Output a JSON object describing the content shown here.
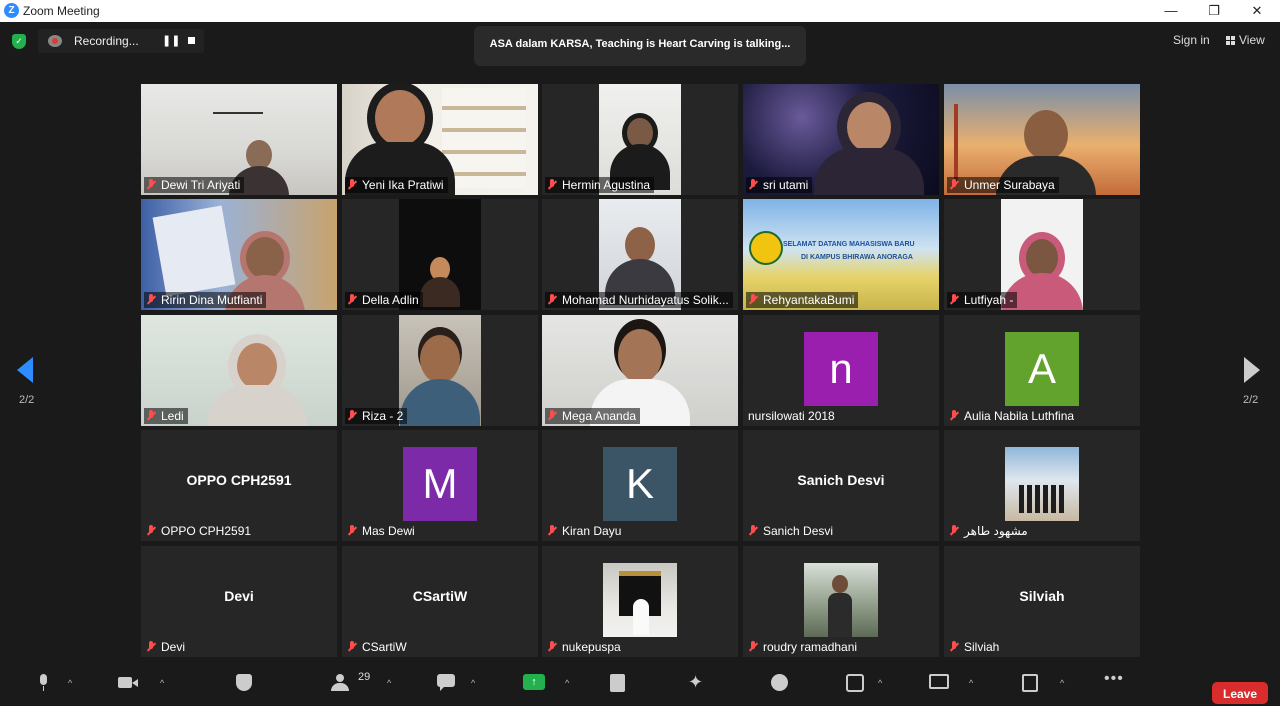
{
  "window": {
    "title": "Zoom Meeting",
    "minimize": "—",
    "restore": "❐",
    "close": "✕"
  },
  "topbar": {
    "recording_label": "Recording...",
    "talking": "ASA dalam KARSA, Teaching is Heart Carving is talking...",
    "signin": "Sign in",
    "view": "View"
  },
  "pager": {
    "left": "2/2",
    "right": "2/2"
  },
  "tiles": [
    {
      "name": "Dewi Tri Ariyati"
    },
    {
      "name": "Yeni Ika Pratiwi"
    },
    {
      "name": "Hermin Agustina"
    },
    {
      "name": "sri utami"
    },
    {
      "name": "Unmer Surabaya"
    },
    {
      "name": "Ririn Dina Mutfianti"
    },
    {
      "name": "Della Adlin"
    },
    {
      "name": "Mohamad Nurhidayatus Solik..."
    },
    {
      "name": "RehyantakaBumi",
      "banner_line1": "SELAMAT DATANG MAHASISWA BARU",
      "banner_line2": "DI KAMPUS BHIRAWA ANORAGA"
    },
    {
      "name": "Lutfiyah -"
    },
    {
      "name": "Ledi"
    },
    {
      "name": "Riza - 2"
    },
    {
      "name": "Mega Ananda"
    },
    {
      "name": "nursilowati 2018",
      "avatar_letter": "n",
      "avatar_color": "#9b1fae"
    },
    {
      "name": "Aulia Nabila Luthfina",
      "avatar_letter": "A",
      "avatar_color": "#62a32e"
    },
    {
      "name": "OPPO CPH2591",
      "center_text": "OPPO CPH2591"
    },
    {
      "name": "Mas Dewi",
      "avatar_letter": "M",
      "avatar_color": "#7d2aa8"
    },
    {
      "name": "Kiran Dayu",
      "avatar_letter": "K",
      "avatar_color": "#3c5566"
    },
    {
      "name": "Sanich Desvi",
      "center_text": "Sanich Desvi"
    },
    {
      "name": "مشهود طاهر"
    },
    {
      "name": "Devi",
      "center_text": "Devi"
    },
    {
      "name": "CSartiW",
      "center_text": "CSartiW"
    },
    {
      "name": "nukepuspa"
    },
    {
      "name": "roudry ramadhani"
    },
    {
      "name": "Silviah",
      "center_text": "Silviah"
    }
  ],
  "toolbar": {
    "participants_count": "29",
    "leave": "Leave"
  },
  "colors": {
    "accent": "#2d8cff",
    "leave": "#d92d2d",
    "muted_mic": "#ff4d4d"
  }
}
